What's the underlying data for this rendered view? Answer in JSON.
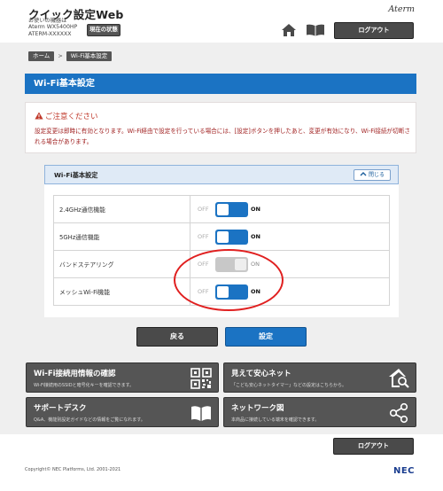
{
  "header": {
    "app_title": "クイック設定Web",
    "device_line1": "お使いの機器は",
    "device_line2": "Aterm WX5400HP",
    "device_line3": "ATERM-XXXXXX",
    "status_button": "現在の状態",
    "brand": "Aterm",
    "logout": "ログアウト"
  },
  "breadcrumb": {
    "home": "ホーム",
    "separator": ">",
    "current": "Wi-Fi基本設定"
  },
  "page_title": "Wi-Fi基本設定",
  "notice": {
    "heading": "ご注意ください",
    "text": "設定変更は即時に有効となります。Wi-Fi経由で設定を行っている場合には、[設定]ボタンを押したあと、変更が有効になり、Wi-Fi接続が切断される場合があります。"
  },
  "panel": {
    "title": "Wi-Fi基本設定",
    "close_button": "閉じる",
    "rows": [
      {
        "label": "2.4GHz通信機能",
        "off": "OFF",
        "on": "ON",
        "state": "on",
        "enabled": true
      },
      {
        "label": "5GHz通信機能",
        "off": "OFF",
        "on": "ON",
        "state": "on",
        "enabled": true
      },
      {
        "label": "バンドステアリング",
        "off": "OFF",
        "on": "ON",
        "state": "on",
        "enabled": false
      },
      {
        "label": "メッシュWi-Fi機能",
        "off": "OFF",
        "on": "ON",
        "state": "on",
        "enabled": true
      }
    ]
  },
  "buttons": {
    "back": "戻る",
    "set": "設定"
  },
  "cards": [
    {
      "title": "Wi-Fi接続用情報の確認",
      "subtitle": "Wi-Fi接続用のSSIDと暗号化キーを確認できます。",
      "icon": "qr-code-icon"
    },
    {
      "title": "見えて安心ネット",
      "subtitle": "「こども安心ネットタイマー」などの設定はこちらから。",
      "icon": "house-search-icon"
    },
    {
      "title": "サポートデスク",
      "subtitle": "Q&A、機能別設定ガイドなどの情報をご覧になれます。",
      "icon": "book-icon"
    },
    {
      "title": "ネットワーク図",
      "subtitle": "本商品に接続している端末を確認できます。",
      "icon": "share-nodes-icon"
    }
  ],
  "footer": {
    "logout": "ログアウト",
    "copyright": "Copyright© NEC Platforms, Ltd. 2001-2021",
    "logo": "NEC"
  },
  "colors": {
    "accent": "#1b73c3",
    "dark_button": "#4a4a4a",
    "warning": "#c0392b",
    "highlight": "#e02020"
  }
}
